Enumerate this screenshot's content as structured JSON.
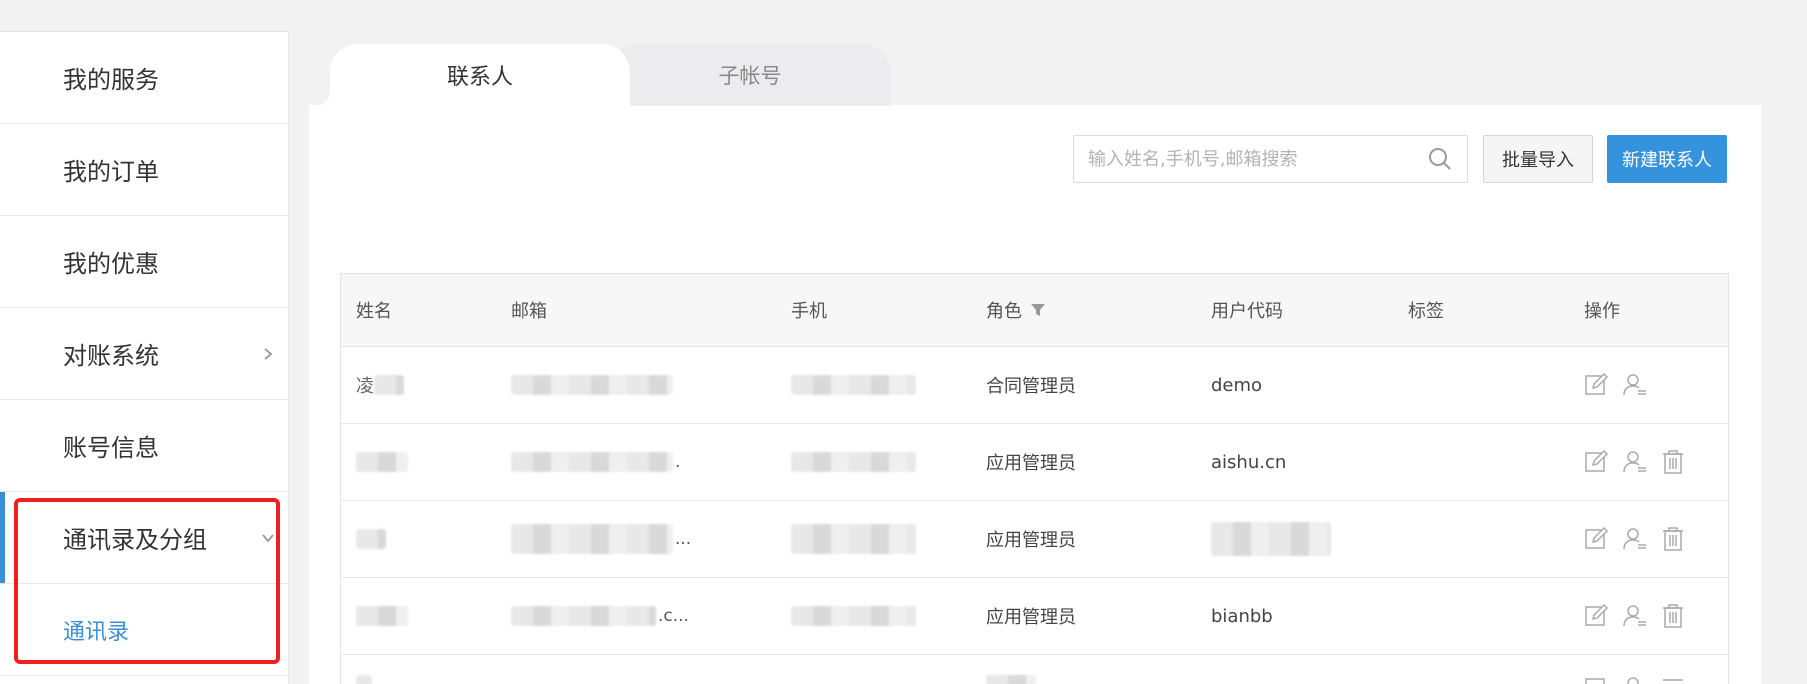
{
  "sidebar": {
    "items": [
      {
        "label": "我的服务"
      },
      {
        "label": "我的订单"
      },
      {
        "label": "我的优惠"
      },
      {
        "label": "对账系统"
      },
      {
        "label": "账号信息"
      },
      {
        "label": "通讯录及分组"
      }
    ],
    "sub_items": [
      {
        "label": "通讯录"
      }
    ]
  },
  "tabs": [
    {
      "label": "联系人",
      "active": true
    },
    {
      "label": "子帐号",
      "active": false
    }
  ],
  "toolbar": {
    "search_placeholder": "输入姓名,手机号,邮箱搜索",
    "import_label": "批量导入",
    "new_label": "新建联系人"
  },
  "table": {
    "columns": [
      "姓名",
      "邮箱",
      "手机",
      "角色",
      "用户代码",
      "标签",
      "操作"
    ],
    "rows": [
      {
        "name_prefix": "凌",
        "email_suffix": "",
        "role": "合同管理员",
        "code": "demo",
        "ops": [
          "edit",
          "user"
        ]
      },
      {
        "name_prefix": "",
        "email_suffix": ".",
        "role": "应用管理员",
        "code": "aishu.cn",
        "ops": [
          "edit",
          "user",
          "delete"
        ]
      },
      {
        "name_prefix": "",
        "email_suffix": "...",
        "role": "应用管理员",
        "code": "",
        "ops": [
          "edit",
          "user",
          "delete"
        ]
      },
      {
        "name_prefix": "",
        "email_suffix": ".c...",
        "role": "应用管理员",
        "code": "bianbb",
        "ops": [
          "edit",
          "user",
          "delete"
        ]
      }
    ]
  },
  "colors": {
    "accent": "#3592dc",
    "active_link": "#3b8fd6",
    "highlight": "#ef1f1f"
  }
}
